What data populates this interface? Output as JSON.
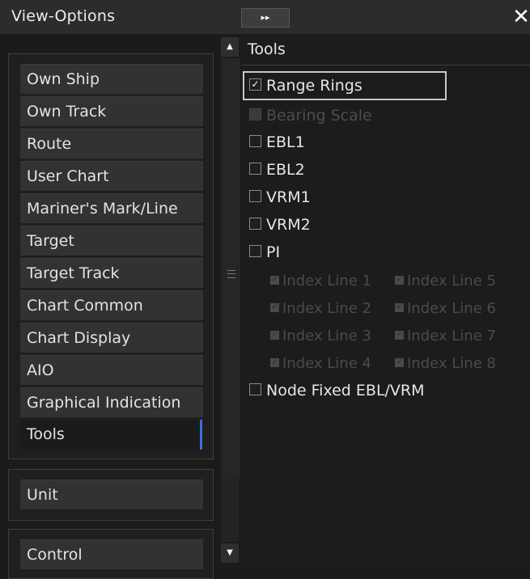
{
  "window": {
    "title": "View-Options",
    "expand_glyph": "▸▸",
    "close_glyph": "✕"
  },
  "sidebar": {
    "categories": [
      "Own Ship",
      "Own Track",
      "Route",
      "User Chart",
      "Mariner's Mark/Line",
      "Target",
      "Target Track",
      "Chart Common",
      "Chart Display",
      "AIO",
      "Graphical Indication",
      "Tools"
    ],
    "active": "Tools",
    "unit_label": "Unit",
    "control_label": "Control"
  },
  "scroll": {
    "up_glyph": "▲",
    "down_glyph": "▼"
  },
  "tools": {
    "title": "Tools",
    "options": [
      {
        "label": "Range Rings",
        "checked": true,
        "enabled": true
      },
      {
        "label": "Bearing Scale",
        "checked": false,
        "enabled": false
      },
      {
        "label": "EBL1",
        "checked": false,
        "enabled": true
      },
      {
        "label": "EBL2",
        "checked": false,
        "enabled": true
      },
      {
        "label": "VRM1",
        "checked": false,
        "enabled": true
      },
      {
        "label": "VRM2",
        "checked": false,
        "enabled": true
      },
      {
        "label": "PI",
        "checked": false,
        "enabled": true
      }
    ],
    "index_lines": [
      "Index Line 1",
      "Index Line 5",
      "Index Line 2",
      "Index Line 6",
      "Index Line 3",
      "Index Line 7",
      "Index Line 4",
      "Index Line 8"
    ],
    "node_fixed": {
      "label": "Node Fixed EBL/VRM",
      "checked": false
    },
    "check_glyph": "✓"
  },
  "colors": {
    "background": "#1b1b1b",
    "button": "#323232",
    "active_marker": "#3f6fd6",
    "focus_frame": "#c8c8c8",
    "disabled_text": "#4d4d4d"
  }
}
